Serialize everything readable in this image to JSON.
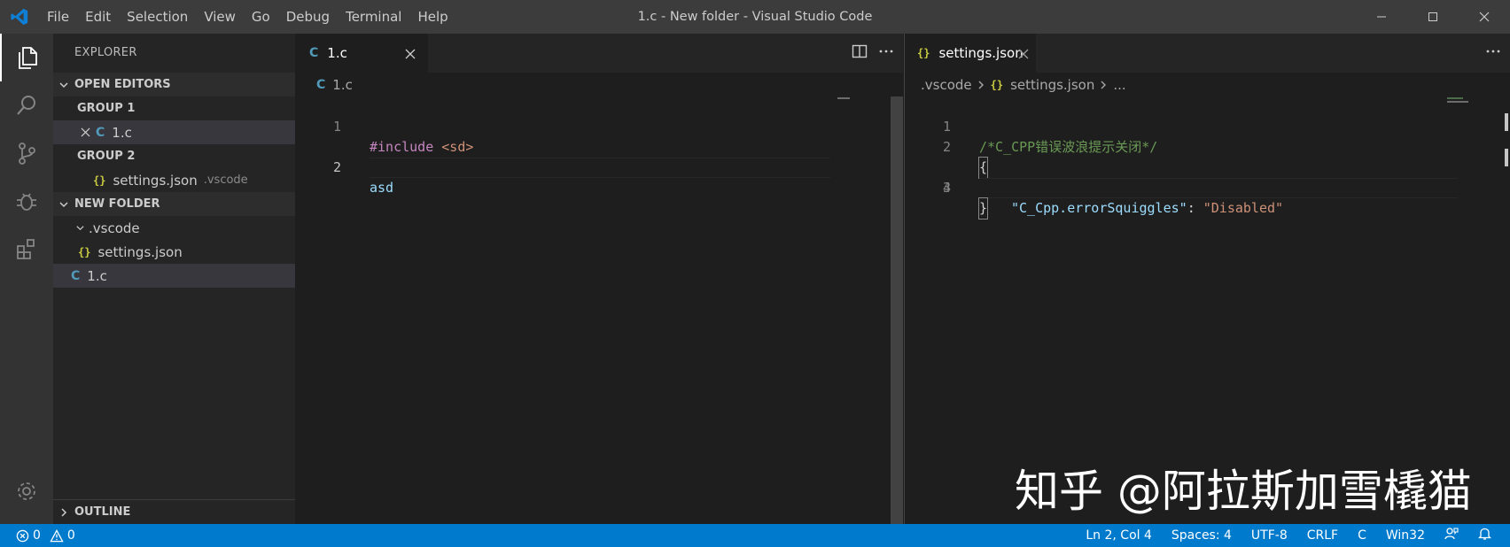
{
  "titlebar": {
    "title": "1.c - New folder - Visual Studio Code",
    "menu": [
      "File",
      "Edit",
      "Selection",
      "View",
      "Go",
      "Debug",
      "Terminal",
      "Help"
    ]
  },
  "sidebar": {
    "header": "EXPLORER",
    "open_editors": {
      "label": "OPEN EDITORS",
      "group1": "GROUP 1",
      "group1_file": "1.c",
      "group2": "GROUP 2",
      "group2_file": "settings.json",
      "group2_file_dir": ".vscode"
    },
    "folder": {
      "label": "NEW FOLDER",
      "vscode_dir": ".vscode",
      "settings_file": "settings.json",
      "c_file": "1.c"
    },
    "outline": "OUTLINE"
  },
  "left_editor": {
    "tab_label": "1.c",
    "tab_icon": "C",
    "breadcrumb": "1.c",
    "line_numbers": [
      "1",
      "2"
    ],
    "line1_keyword": "#include",
    "line1_header": "<sd>",
    "line2_text": "asd"
  },
  "right_editor": {
    "tab_label": "settings.json",
    "tab_icon": "{}",
    "breadcrumb": {
      "folder": ".vscode",
      "file": "settings.json",
      "ellipsis": "..."
    },
    "line_numbers": [
      "1",
      "2",
      "3",
      "4"
    ],
    "line1_comment": "/*C_CPP错误波浪提示关闭*/",
    "line2_brace": "{",
    "line3_key": "\"C_Cpp.errorSquiggles\"",
    "line3_colon": ": ",
    "line3_value": "\"Disabled\"",
    "line4_brace": "}"
  },
  "watermark": "知乎 @阿拉斯加雪橇猫",
  "statusbar": {
    "errors": "0",
    "warnings": "0",
    "position": "Ln 2, Col 4",
    "spaces": "Spaces: 4",
    "encoding": "UTF-8",
    "eol": "CRLF",
    "language": "C",
    "platform": "Win32"
  },
  "colors": {
    "accent": "#007acc",
    "titlebar": "#3c3c3c",
    "activitybar": "#333333",
    "sidebar": "#252526",
    "editor": "#1e1e1e"
  }
}
